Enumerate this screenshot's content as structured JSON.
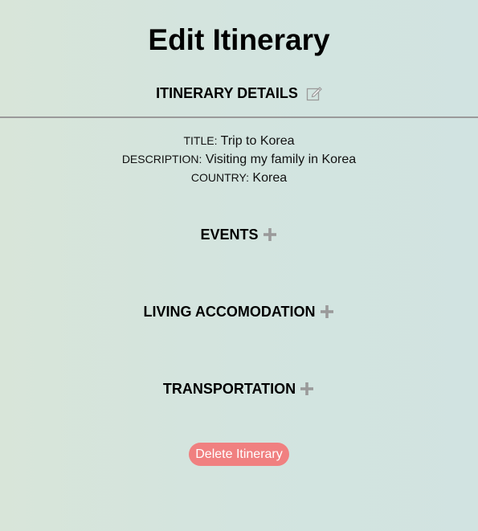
{
  "page": {
    "title": "Edit Itinerary"
  },
  "itinerary_details": {
    "heading": "ITINERARY DETAILS",
    "edit_icon": "edit-icon",
    "fields": [
      {
        "key": "TITLE:",
        "value": "Trip to Korea"
      },
      {
        "key": "DESCRIPTION:",
        "value": "Visiting my family in Korea"
      },
      {
        "key": "COUNTRY:",
        "value": "Korea"
      }
    ]
  },
  "sections": {
    "events": {
      "heading": "EVENTS",
      "icon": "plus-icon"
    },
    "living": {
      "heading": "LIVING ACCOMODATION",
      "icon": "plus-icon"
    },
    "transportation": {
      "heading": "TRANSPORTATION",
      "icon": "plus-icon"
    }
  },
  "actions": {
    "delete_label": "Delete Itinerary"
  },
  "colors": {
    "delete_button": "#f08080",
    "icon_gray": "#9a9a9a",
    "background_left": "#d8e5d9",
    "background_right": "#d1e3e1"
  }
}
